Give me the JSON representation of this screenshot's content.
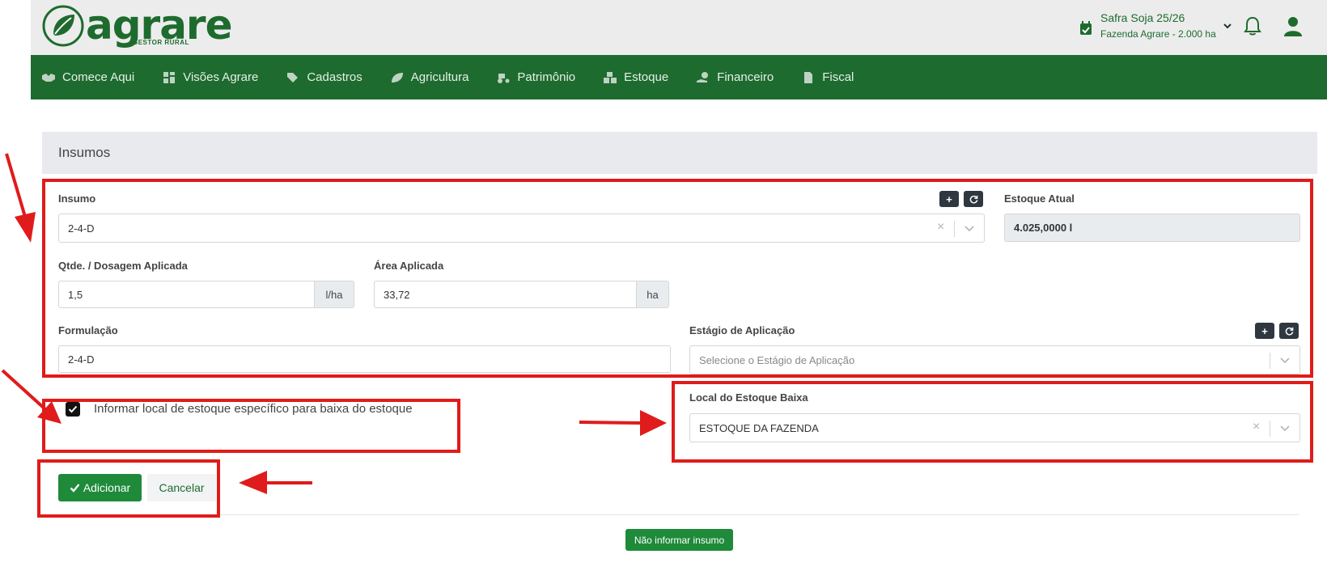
{
  "brand": {
    "name": "agrare",
    "tagline": "GESTOR RURAL"
  },
  "header": {
    "season_title": "Safra Soja 25/26",
    "season_subtitle": "Fazenda Agrare - 2.000 ha",
    "icons": [
      "calendar-check-icon",
      "chevron-down-icon",
      "bell-icon",
      "user-icon"
    ]
  },
  "nav": [
    {
      "label": "Comece Aqui",
      "icon": "handshake-icon"
    },
    {
      "label": "Visões Agrare",
      "icon": "dashboard-icon"
    },
    {
      "label": "Cadastros",
      "icon": "tags-icon"
    },
    {
      "label": "Agricultura",
      "icon": "leaf-icon"
    },
    {
      "label": "Patrimônio",
      "icon": "tractor-icon"
    },
    {
      "label": "Estoque",
      "icon": "boxes-icon"
    },
    {
      "label": "Financeiro",
      "icon": "hand-coin-icon"
    },
    {
      "label": "Fiscal",
      "icon": "file-icon"
    }
  ],
  "panel": {
    "title": "Insumos",
    "insumo": {
      "label": "Insumo",
      "value": "2-4-D"
    },
    "estoque_atual": {
      "label": "Estoque Atual",
      "value": "4.025,0000 l"
    },
    "dosagem": {
      "label": "Qtde. / Dosagem Aplicada",
      "value": "1,5",
      "unit": "l/ha"
    },
    "area": {
      "label": "Área Aplicada",
      "value": "33,72",
      "unit": "ha"
    },
    "formulacao": {
      "label": "Formulação",
      "value": "2-4-D"
    },
    "estagio": {
      "label": "Estágio de Aplicação",
      "placeholder": "Selecione o Estágio de Aplicação"
    },
    "checkbox_label": "Informar local de estoque específico para baixa do estoque",
    "checkbox_checked": true,
    "local_estoque": {
      "label": "Local do Estoque Baixa",
      "value": "ESTOQUE DA FAZENDA"
    },
    "add_button": "Adicionar",
    "cancel_button": "Cancelar",
    "skip_button": "Não informar insumo",
    "plus_symbol": "+"
  },
  "colors": {
    "brand_green": "#1d6b2f",
    "button_green": "#1e8a3a",
    "annotation_red": "#e01b1b"
  }
}
